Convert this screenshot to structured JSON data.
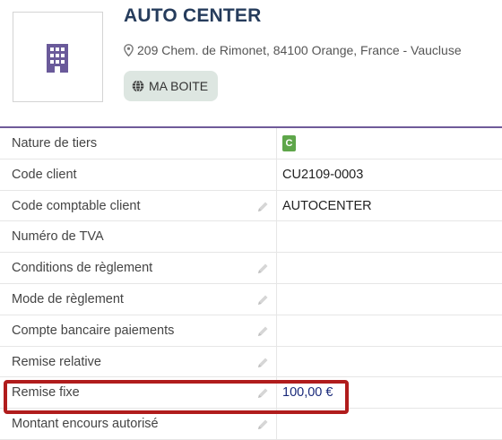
{
  "company": {
    "name": "AUTO CENTER",
    "address": "209 Chem. de Rimonet, 84100 Orange, France - Vaucluse",
    "badge_label": "MA BOITE"
  },
  "rows": [
    {
      "label": "Nature de tiers",
      "value": "C",
      "editable": false
    },
    {
      "label": "Code client",
      "value": "CU2109-0003",
      "editable": false
    },
    {
      "label": "Code comptable client",
      "value": "AUTOCENTER",
      "editable": true
    },
    {
      "label": "Numéro de TVA",
      "value": "",
      "editable": false
    },
    {
      "label": "Conditions de règlement",
      "value": "",
      "editable": true
    },
    {
      "label": "Mode de règlement",
      "value": "",
      "editable": true
    },
    {
      "label": "Compte bancaire paiements",
      "value": "",
      "editable": true
    },
    {
      "label": "Remise relative",
      "value": "",
      "editable": true
    },
    {
      "label": "Remise fixe",
      "value": "100,00 €",
      "editable": true
    },
    {
      "label": "Montant encours autorisé",
      "value": "",
      "editable": true
    }
  ],
  "colors": {
    "title": "#263c5c",
    "table_border": "#6f5b99",
    "nature_badge": "#5ea64a",
    "highlight": "#b01c1c",
    "money": "#1a2a7a"
  }
}
